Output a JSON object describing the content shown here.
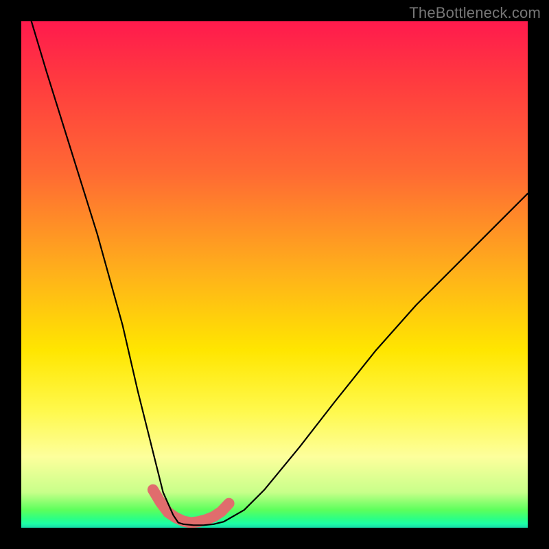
{
  "watermark": "TheBottleneck.com",
  "chart_data": {
    "type": "line",
    "title": "",
    "xlabel": "",
    "ylabel": "",
    "xlim": [
      0,
      100
    ],
    "ylim": [
      0,
      100
    ],
    "series": [
      {
        "name": "bottleneck-curve",
        "x": [
          2,
          5,
          10,
          15,
          20,
          23,
          26,
          28,
          30,
          31,
          32,
          34,
          36,
          38,
          40,
          44,
          48,
          55,
          62,
          70,
          78,
          86,
          94,
          100
        ],
        "values": [
          100,
          90,
          74,
          58,
          40,
          27,
          15,
          7,
          2.5,
          1,
          0.7,
          0.5,
          0.5,
          0.7,
          1.2,
          3.5,
          7.5,
          16,
          25,
          35,
          44,
          52,
          60,
          66
        ]
      },
      {
        "name": "highlight-band",
        "x": [
          26,
          27.5,
          29,
          30.5,
          32,
          33.5,
          35,
          36.5,
          38,
          39.5,
          41
        ],
        "values": [
          7.5,
          5,
          3,
          2,
          1.3,
          1,
          1.2,
          1.6,
          2.2,
          3.2,
          4.8
        ]
      }
    ],
    "gradient_stops": [
      {
        "pos": 0,
        "color": "#ff1a4d"
      },
      {
        "pos": 0.3,
        "color": "#ff6a33"
      },
      {
        "pos": 0.65,
        "color": "#ffe600"
      },
      {
        "pos": 0.93,
        "color": "#c8ff8a"
      },
      {
        "pos": 1.0,
        "color": "#18d9a8"
      }
    ],
    "highlight_color": "#e06d6d"
  }
}
